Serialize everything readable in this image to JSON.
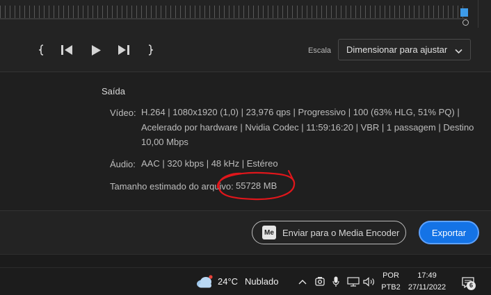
{
  "transport": {
    "scale_label": "Escala",
    "scale_value": "Dimensionar para ajustar"
  },
  "output": {
    "section_title": "Saída",
    "video_label": "Vídeo:",
    "video_line1": "H.264 | 1080x1920 (1,0) | 23,976 qps | Progressivo | 100 (63% HLG, 51% PQ) |",
    "video_line2": "Acelerado por hardware | Nvidia Codec | 11:59:16:20 | VBR | 1 passagem | Destino",
    "video_line3": "10,00 Mbps",
    "audio_label": "Áudio:",
    "audio_value": "AAC | 320 kbps | 48 kHz | Estéreo",
    "size_label": "Tamanho estimado do arquivo:",
    "size_value": "55728 MB"
  },
  "actions": {
    "media_encoder_badge": "Me",
    "media_encoder_label": "Enviar para o Media Encoder",
    "export_label": "Exportar"
  },
  "taskbar": {
    "weather_temp": "24°C",
    "weather_desc": "Nublado",
    "lang_line1": "POR",
    "lang_line2": "PTB2",
    "time": "17:49",
    "date": "27/11/2022",
    "notification_count": "6"
  },
  "colors": {
    "accent": "#1473e6",
    "annotation": "#e0161b",
    "background": "#1f1f1f"
  }
}
